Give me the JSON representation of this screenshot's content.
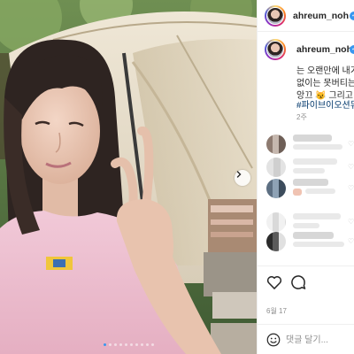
{
  "post": {
    "username": "ahreum_noh",
    "caption_lines": [
      "는 오랜만에 내가",
      "없이는 못버티는",
      "앙끄 😼 그리고"
    ],
    "hashtag": "#파이브이오션뮤",
    "post_time": "2주"
  },
  "photo": {
    "slide_count": 10,
    "active_slide": 1
  },
  "footer": {
    "date": "6월 17",
    "comment_placeholder": "댓글 달기..."
  },
  "icons": {
    "like": "heart-icon",
    "comment": "comment-bubble-icon",
    "emoji": "smiley-icon",
    "next": "chevron-right-icon"
  },
  "colors": {
    "verified": "#3897f0",
    "hashtag": "#00376b",
    "active_dot": "#3897f0",
    "muted_text": "#8e8e8e"
  }
}
